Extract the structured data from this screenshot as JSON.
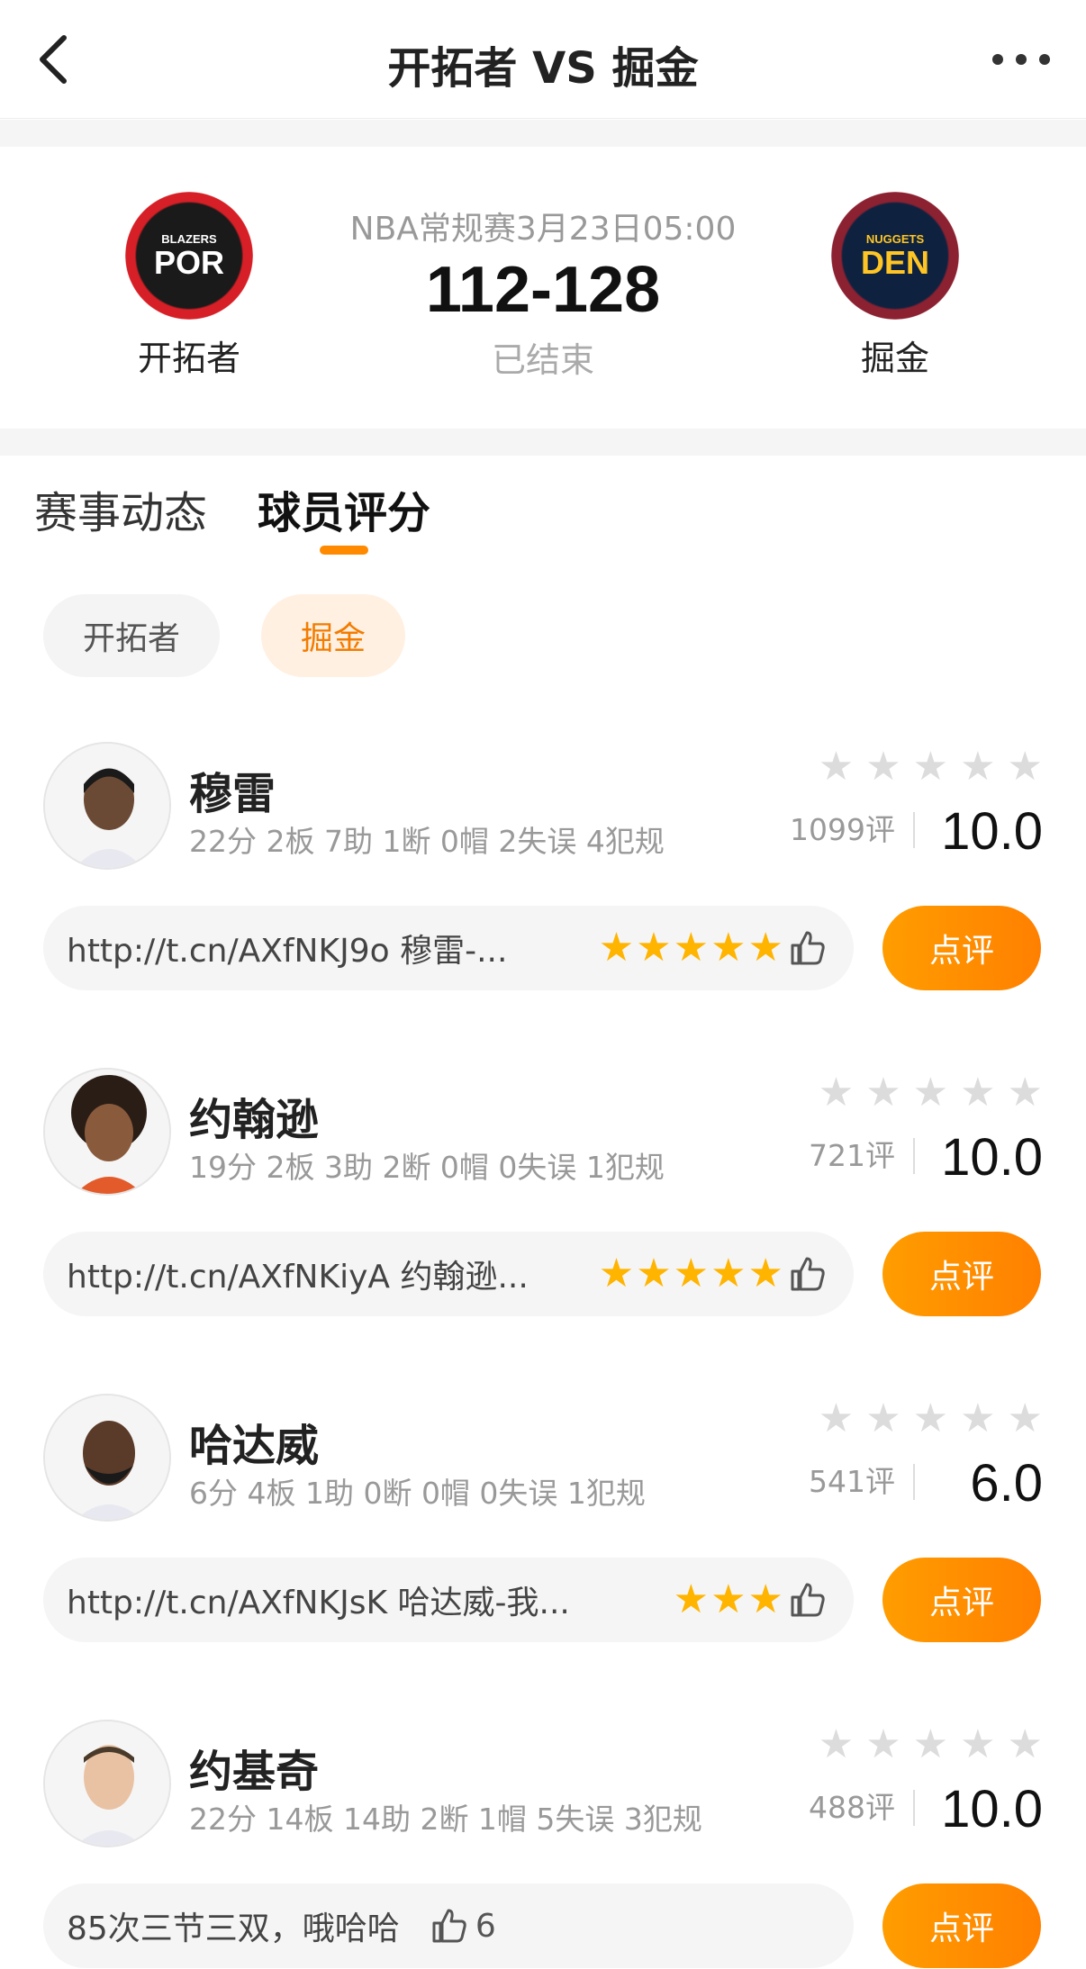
{
  "header": {
    "title": "开拓者 VS 掘金"
  },
  "match": {
    "meta": "NBA常规赛3月23日05:00",
    "score": "112-128",
    "status": "已结束",
    "home": {
      "name": "开拓者",
      "logo_top": "BLAZERS",
      "logo_abbr": "POR"
    },
    "away": {
      "name": "掘金",
      "logo_top": "NUGGETS",
      "logo_abbr": "DEN"
    }
  },
  "tabs": [
    {
      "label": "赛事动态"
    },
    {
      "label": "球员评分"
    }
  ],
  "team_filter": [
    {
      "label": "开拓者"
    },
    {
      "label": "掘金"
    }
  ],
  "colors": {
    "accent": "#ff8a00",
    "star_filled": "#ffb400",
    "star_empty": "#dcdcdc"
  },
  "players": [
    {
      "name": "穆雷",
      "stats": "22分 2板 7助 1断 0帽 2失误 4犯规",
      "votes": "1099评",
      "rating": "10.0",
      "comment": "http://t.cn/AXfNKJ9o 穆雷-...",
      "comment_stars": 5,
      "likes": "",
      "button": "点评"
    },
    {
      "name": "约翰逊",
      "stats": "19分 2板 3助 2断 0帽 0失误 1犯规",
      "votes": "721评",
      "rating": "10.0",
      "comment": "http://t.cn/AXfNKiyA 约翰逊...",
      "comment_stars": 5,
      "likes": "",
      "button": "点评"
    },
    {
      "name": "哈达威",
      "stats": "6分 4板 1助 0断 0帽 0失误 1犯规",
      "votes": "541评",
      "rating": "6.0",
      "comment": "http://t.cn/AXfNKJsK 哈达威-我...",
      "comment_stars": 3,
      "likes": "",
      "button": "点评"
    },
    {
      "name": "约基奇",
      "stats": "22分 14板 14助 2断 1帽 5失误 3犯规",
      "votes": "488评",
      "rating": "10.0",
      "comment": "85次三节三双，哦哈哈",
      "comment_stars": 0,
      "likes": "6",
      "button": "点评"
    }
  ]
}
